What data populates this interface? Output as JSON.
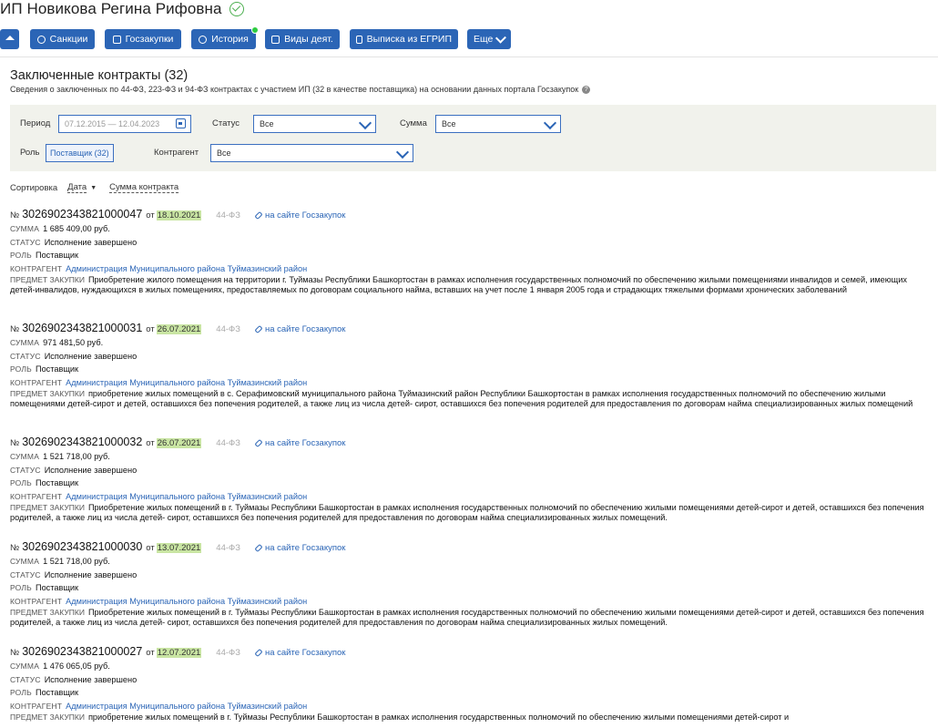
{
  "header": {
    "title": "ИП Новикова Регина Рифовна",
    "buttons": [
      {
        "label": ""
      },
      {
        "label": "Санкции"
      },
      {
        "label": "Госзакупки"
      },
      {
        "label": "История"
      },
      {
        "label": "Виды деят."
      },
      {
        "label": "Выписка из ЕГРИП"
      },
      {
        "label": "Еще"
      }
    ]
  },
  "section": {
    "title": "Заключенные контракты (32)",
    "subtitle": "Сведения о заключенных по 44-ФЗ, 223-ФЗ и 94-ФЗ контрактах с участием ИП (32 в качестве поставщика) на основании данных портала Госзакупок"
  },
  "filters": {
    "period_label": "Период",
    "period_placeholder": "07.12.2015 — 12.04.2023",
    "status_label": "Статус",
    "status_value": "Все",
    "sum_label": "Сумма",
    "sum_value": "Все",
    "role_label": "Роль",
    "role_value": "Поставщик (32)",
    "counterparty_label": "Контрагент",
    "counterparty_value": "Все"
  },
  "sort": {
    "label": "Сортировка",
    "by_date": "Дата",
    "by_sum": "Сумма контракта"
  },
  "labels": {
    "no": "№",
    "ot": "от",
    "site_link": "на сайте Госзакупок",
    "sum": "СУММА",
    "status": "СТАТУС",
    "role": "РОЛЬ",
    "counterparty": "КОНТРАГЕНТ",
    "subject": "ПРЕДМЕТ ЗАКУПКИ"
  },
  "colors": {
    "accent": "#2b65b6",
    "date_highlight": "#c9e5a3",
    "filter_bg": "#f1f2ec"
  },
  "contracts": [
    {
      "number": "3026902343821000047",
      "date": "18.10.2021",
      "law": "44-ФЗ",
      "sum": "1 685 409,00 руб.",
      "status": "Исполнение завершено",
      "role": "Поставщик",
      "counterparty": "Администрация Муниципального района Туймазинский район",
      "subject": "Приобретение жилого помещения на территории г. Туймазы Республики Башкортостан в рамках исполнения государственных полномочий по обеспечению жилыми помещениями инвалидов и семей, имеющих детей-инвалидов, нуждающихся в жилых помещениях, предоставляемых по договорам социального найма, вставших на учет после 1 января 2005 года и страдающих тяжелыми формами хронических заболеваний"
    },
    {
      "number": "3026902343821000031",
      "date": "26.07.2021",
      "law": "44-ФЗ",
      "sum": "971 481,50 руб.",
      "status": "Исполнение завершено",
      "role": "Поставщик",
      "counterparty": "Администрация Муниципального района Туймазинский район",
      "subject": "приобретение жилых помещений в с. Серафимовский муниципального района Туймазинский район Республики Башкортостан в рамках исполнения государственных полномочий по обеспечению жилыми помещениями детей-сирот и детей, оставшихся без попечения родителей, а также лиц из числа детей- сирот, оставшихся без попечения родителей для предоставления по договорам найма специализированных жилых помещений"
    },
    {
      "number": "3026902343821000032",
      "date": "26.07.2021",
      "law": "44-ФЗ",
      "sum": "1 521 718,00 руб.",
      "status": "Исполнение завершено",
      "role": "Поставщик",
      "counterparty": "Администрация Муниципального района Туймазинский район",
      "subject": "Приобретение жилых помещений в г. Туймазы Республики Башкортостан в рамках исполнения государственных полномочий по обеспечению жилыми помещениями детей-сирот и детей, оставшихся без попечения родителей, а также лиц из числа детей- сирот, оставшихся без попечения родителей для предоставления по договорам найма специализированных жилых помещений."
    },
    {
      "number": "3026902343821000030",
      "date": "13.07.2021",
      "law": "44-ФЗ",
      "sum": "1 521 718,00 руб.",
      "status": "Исполнение завершено",
      "role": "Поставщик",
      "counterparty": "Администрация Муниципального района Туймазинский район",
      "subject": "Приобретение жилых помещений в г. Туймазы Республики Башкортостан в рамках исполнения государственных полномочий по обеспечению жилыми помещениями детей-сирот и детей, оставшихся без попечения родителей, а также лиц из числа детей- сирот, оставшихся без попечения родителей для предоставления по договорам найма специализированных жилых помещений."
    },
    {
      "number": "3026902343821000027",
      "date": "12.07.2021",
      "law": "44-ФЗ",
      "sum": "1 476 065,05 руб.",
      "status": "Исполнение завершено",
      "role": "Поставщик",
      "counterparty": "Администрация Муниципального района Туймазинский район",
      "subject": "приобретение жилых помещений в г. Туймазы Республики Башкортостан в рамках исполнения государственных полномочий по обеспечению жилыми помещениями детей-сирот и"
    }
  ]
}
